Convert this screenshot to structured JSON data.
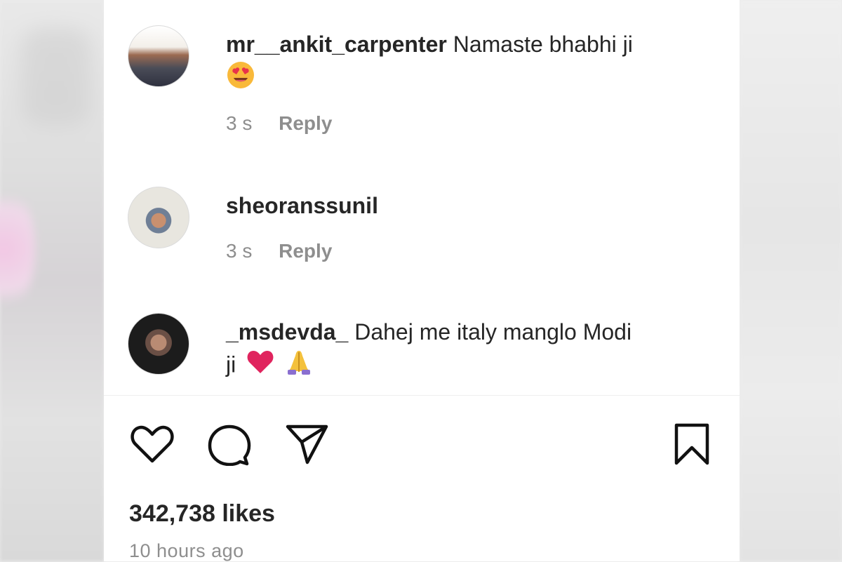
{
  "comments": [
    {
      "username": "mr__ankit_carpenter",
      "text": "Namaste bhabhi ji",
      "emojis": [
        "smiling-face-with-heart-eyes"
      ],
      "time": "3 s",
      "reply_label": "Reply"
    },
    {
      "username": "sheoranssunil",
      "text": "",
      "emojis": [],
      "time": "3 s",
      "reply_label": "Reply"
    },
    {
      "username": "_msdevda_",
      "text_line1": "Dahej me italy manglo Modi",
      "text_line2": "ji",
      "emojis": [
        "red-heart",
        "folded-hands"
      ]
    }
  ],
  "actions": {
    "icons": [
      "heart-icon",
      "comment-icon",
      "share-icon",
      "bookmark-icon"
    ]
  },
  "post": {
    "likes": "342,738 likes",
    "timestamp": "10 hours ago"
  },
  "colors": {
    "text_primary": "#262626",
    "text_secondary": "#8e8e8e",
    "heart_emoji": "#e0245e"
  }
}
